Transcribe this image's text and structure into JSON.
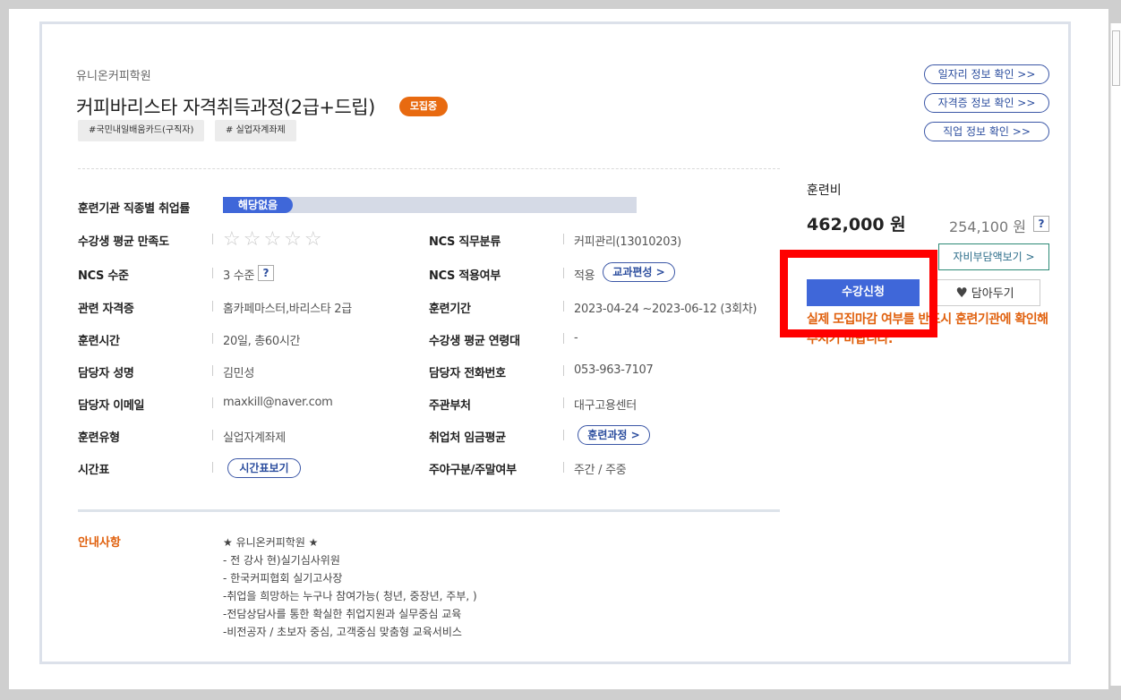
{
  "header": {
    "institute": "유니온커피학원",
    "course_title": "커피바리스타 자격취득과정(2급+드립)",
    "recruit_badge": "모집중",
    "tags": [
      "#국민내일배움카드(구직자)",
      "# 실업자계좌제"
    ],
    "links": [
      "일자리 정보 확인 >>",
      "자격증 정보 확인 >>",
      "직업 정보 확인 >>"
    ]
  },
  "info": {
    "employment_rate_label": "훈련기관 직종별 취업률",
    "employment_rate_value": "해당없음",
    "satisfaction_label": "수강생 평균 만족도",
    "satisfaction_stars": "☆☆☆☆☆",
    "ncs_category_label": "NCS 직무분류",
    "ncs_category_value": "커피관리(13010203)",
    "ncs_level_label": "NCS 수준",
    "ncs_level_value": "3 수준",
    "ncs_applied_label": "NCS 적용여부",
    "ncs_applied_value": "적용",
    "curriculum_btn": "교과편성 >",
    "cert_label": "관련 자격증",
    "cert_value": "홈카페마스터,바리스타 2급",
    "period_label": "훈련기간",
    "period_value": "2023-04-24 ~2023-06-12 (3회차)",
    "hours_label": "훈련시간",
    "hours_value": "20일, 총60시간",
    "age_label": "수강생 평균 연령대",
    "age_value": "-",
    "manager_name_label": "담당자 성명",
    "manager_name_value": "김민성",
    "manager_phone_label": "담당자 전화번호",
    "manager_phone_value": "053-963-7107",
    "manager_email_label": "담당자 이메일",
    "manager_email_value": "maxkill@naver.com",
    "dept_label": "주관부처",
    "dept_value": "대구고용센터",
    "type_label": "훈련유형",
    "type_value": "실업자계좌제",
    "wage_label": "취업처 임금평균",
    "course_btn": "훈련과정 >",
    "schedule_label": "시간표",
    "schedule_btn": "시간표보기",
    "daynight_label": "주야구분/주말여부",
    "daynight_value": "주간 / 주중",
    "qmark": "?"
  },
  "fee": {
    "title": "훈련비",
    "main": "462,000 원",
    "sub": "254,100 원",
    "selfpay_btn": "자비부담액보기 >",
    "apply_btn": "수강신청",
    "wish_btn": "담아두기",
    "warning": "실제 모집마감 여부를 반드시 훈련기관에 확인해 주시기 바랍니다."
  },
  "notice": {
    "label": "안내사항",
    "lines": [
      "★ 유니온커피학원 ★",
      "- 전 강사 현)실기심사위원",
      "- 한국커피협회 실기고사장",
      "-취업을 희망하는 누구나 참여가능( 청년, 중장년, 주부, )",
      "-전담상담사를 통한 확실한 취업지원과 실무중심 교육",
      "-비전공자 / 초보자 중심, 고객중심 맞춤형 교육서비스"
    ]
  },
  "colors": {
    "accent_blue": "#3f67d9",
    "badge_orange": "#e86a10",
    "warning_orange": "#e0600d",
    "highlight_red": "#ff0000"
  }
}
